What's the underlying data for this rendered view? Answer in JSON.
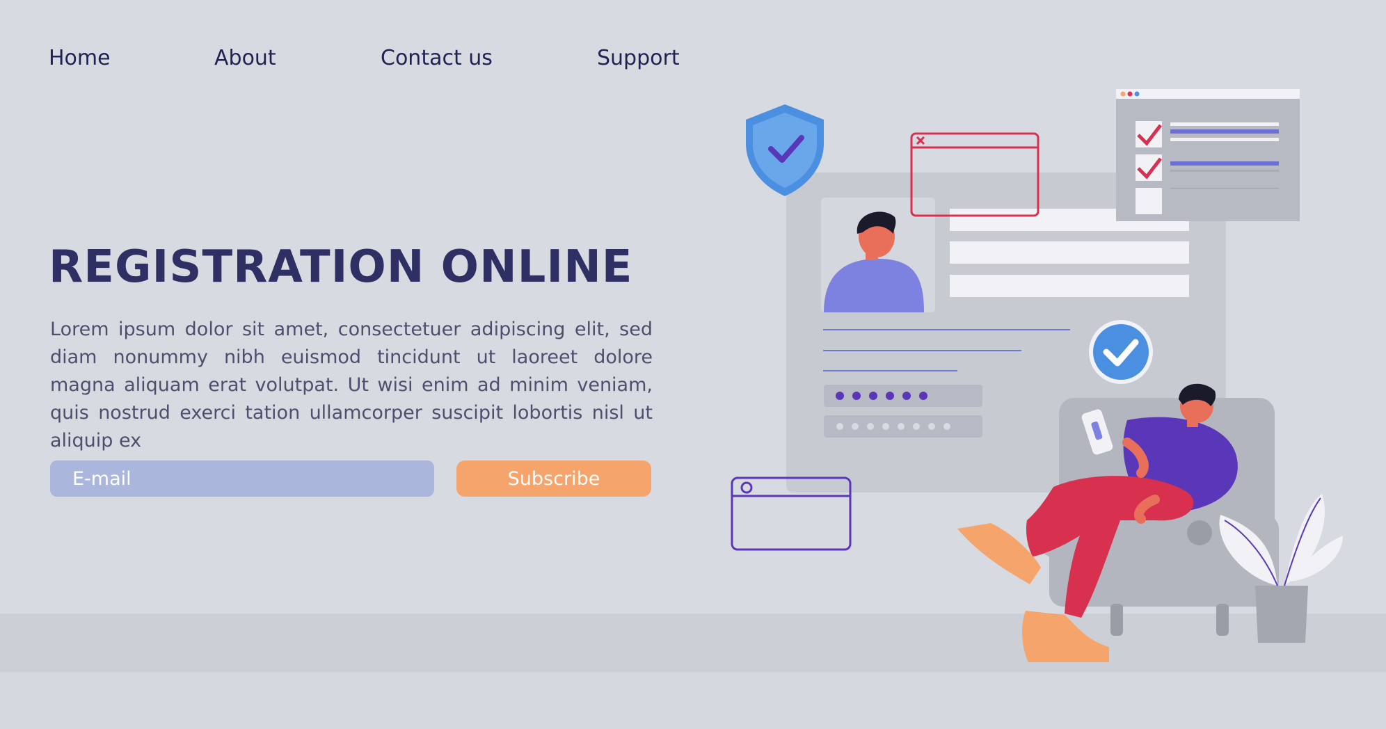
{
  "nav": {
    "items": [
      {
        "label": "Home"
      },
      {
        "label": "About"
      },
      {
        "label": "Contact us"
      },
      {
        "label": "Support"
      }
    ]
  },
  "hero": {
    "title": "REGISTRATION ONLINE",
    "body": "Lorem ipsum dolor sit amet, consectetuer adipiscing elit, sed diam nonummy nibh euismod tincidunt ut laoreet dolore magna aliquam erat volutpat. Ut wisi enim ad minim veniam, quis nostrud exerci tation ullamcorper suscipit lobortis nisl ut aliquip ex"
  },
  "form": {
    "email_placeholder": "E-mail",
    "subscribe_label": "Subscribe"
  },
  "colors": {
    "background": "#d8dae1",
    "heading": "#2e2f63",
    "input": "#aab6dc",
    "button": "#f5a46b",
    "accent_blue": "#4a8fe0",
    "accent_purple": "#5a37b8",
    "accent_red": "#d8304f"
  },
  "illustration": {
    "icons": [
      "shield-check-icon",
      "check-circle-icon",
      "browser-window-icon",
      "checklist-icon",
      "password-field-icon",
      "user-avatar",
      "person-on-sofa",
      "plant-icon"
    ]
  }
}
